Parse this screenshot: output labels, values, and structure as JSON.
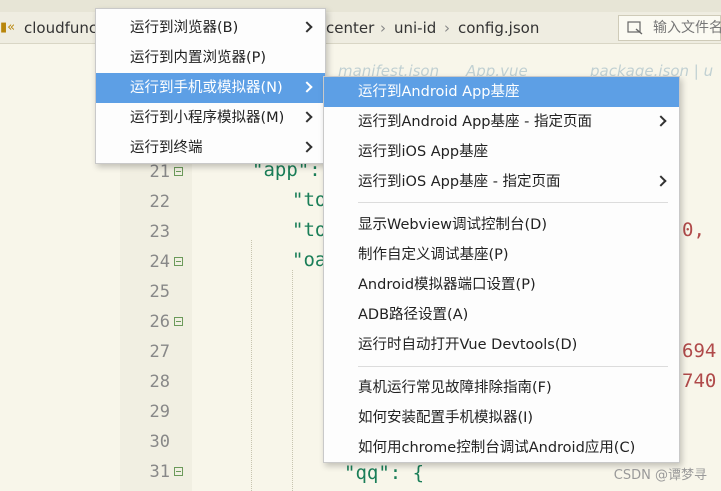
{
  "tabbar": {
    "crumb_prefix": "cloudfunc",
    "crumbs": [
      "center",
      "uni-id",
      "config.json"
    ],
    "filter_placeholder": "输入文件名"
  },
  "faint_tabs": [
    "manifest.json",
    "App.vue",
    "package.json |  u"
  ],
  "editor": {
    "line_numbers": [
      "21",
      "22",
      "23",
      "24",
      "25",
      "26",
      "27",
      "28",
      "29",
      "30",
      "31"
    ],
    "code_app": "\"app\":",
    "code_to1": "\"to",
    "code_to2": "\"to",
    "code_oa": "\"oa",
    "code_right1": "0,",
    "code_right2": "694",
    "code_right3": "740",
    "code_qq": "\"qq\": {"
  },
  "menu_main": {
    "items": [
      {
        "label": "运行到浏览器(B)",
        "has_submenu": true
      },
      {
        "label": "运行到内置浏览器(P)",
        "has_submenu": false
      },
      {
        "label": "运行到手机或模拟器(N)",
        "has_submenu": true,
        "selected": true
      },
      {
        "label": "运行到小程序模拟器(M)",
        "has_submenu": true
      },
      {
        "label": "运行到终端",
        "has_submenu": true
      }
    ]
  },
  "menu_sub": {
    "items": [
      {
        "label": "运行到Android App基座",
        "selected": true
      },
      {
        "label": "运行到Android App基座 - 指定页面",
        "has_submenu": true
      },
      {
        "label": "运行到iOS App基座"
      },
      {
        "label": "运行到iOS App基座 - 指定页面",
        "has_submenu": true
      },
      {
        "label": "显示Webview调试控制台(D)"
      },
      {
        "label": "制作自定义调试基座(P)"
      },
      {
        "label": "Android模拟器端口设置(P)"
      },
      {
        "label": "ADB路径设置(A)"
      },
      {
        "label": "运行时自动打开Vue Devtools(D)"
      },
      {
        "label": "真机运行常见故障排除指南(F)"
      },
      {
        "label": "如何安装配置手机模拟器(I)"
      },
      {
        "label": "如何用chrome控制台调试Android应用(C)"
      }
    ]
  },
  "watermark": "CSDN @谭梦寻",
  "colors": {
    "selection": "#5d9fe5",
    "code_string": "#1a7e58",
    "editor_bg": "#f8f6ea"
  }
}
